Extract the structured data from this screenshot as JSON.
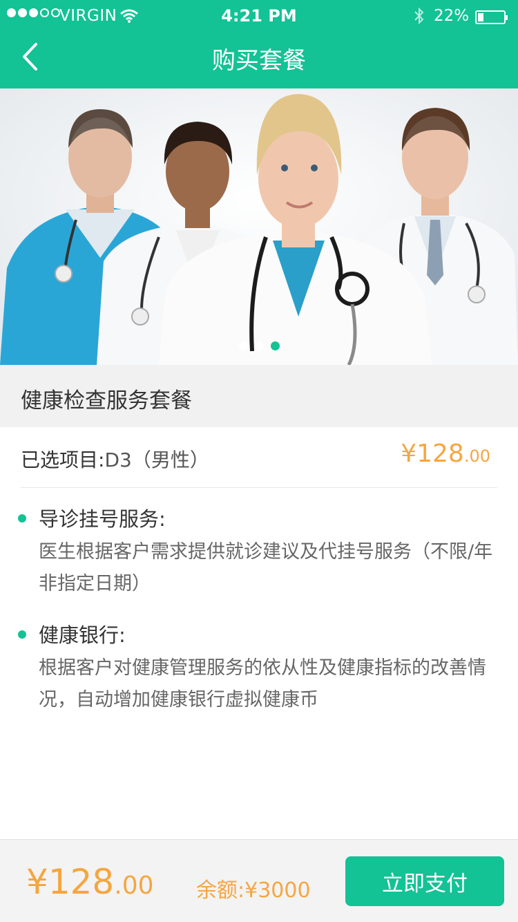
{
  "status_bar": {
    "carrier": "VIRGIN",
    "time": "4:21 PM",
    "battery_percent": "22%",
    "battery_level": 0.22,
    "signal_bars_filled": 3,
    "signal_bars_total": 5
  },
  "nav": {
    "title": "购买套餐",
    "back_icon": "chevron-left-icon"
  },
  "banner": {
    "page_count": 3,
    "active_page": 3
  },
  "package": {
    "title": "健康检查服务套餐"
  },
  "selected": {
    "label": "已选项目:",
    "value": "D3（男性）",
    "price_symbol": "¥",
    "price_int": "128",
    "price_dec": ".00"
  },
  "services": [
    {
      "title": "导诊挂号服务:",
      "desc": "医生根据客户需求提供就诊建议及代挂号服务（不限/年   非指定日期）"
    },
    {
      "title": "健康银行:",
      "desc": "根据客户对健康管理服务的依从性及健康指标的改善情况，自动增加健康银行虚拟健康币"
    }
  ],
  "footer": {
    "price_symbol": "¥",
    "price_int": "128",
    "price_dec": ".00",
    "balance": "余额:¥3000",
    "pay_label": "立即支付"
  },
  "colors": {
    "brand": "#13c295",
    "price": "#f5a640"
  }
}
